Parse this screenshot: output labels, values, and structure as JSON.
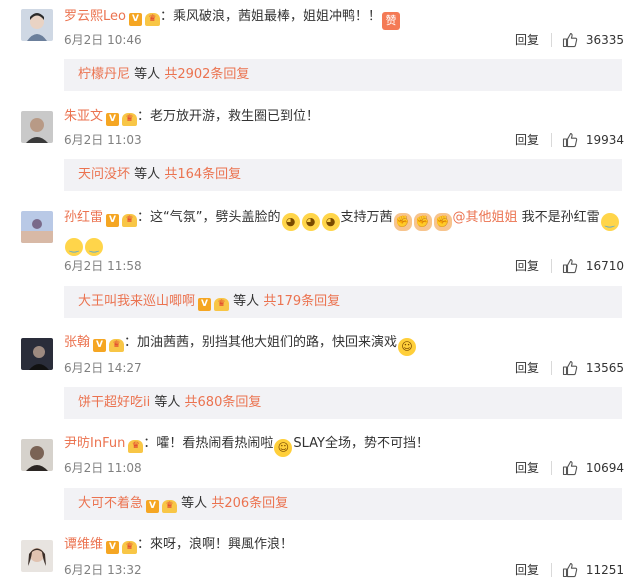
{
  "ui": {
    "reply_label": "回复",
    "etc_label": "等人",
    "badge_v": "V",
    "badge_vip": "♛"
  },
  "comments": [
    {
      "username": "罗云熙Leo",
      "text_parts": [
        "：乘风破浪，茜姐最棒，姐姐冲鸭！！"
      ],
      "emojis": [
        "like-icon"
      ],
      "date": "6月2日 10:46",
      "likes": "36335",
      "reply_user": "柠檬丹尼",
      "reply_total": "共2902条回复"
    },
    {
      "username": "朱亚文",
      "text_parts": [
        "：老万放开游，救生圈已到位！"
      ],
      "date": "6月2日 11:03",
      "likes": "19934",
      "reply_user": "天问没坏",
      "reply_total": "共164条回复"
    },
    {
      "username": "孙红雷",
      "text_parts": [
        "：这“气氛”，劈头盖脸的",
        "支持万茜",
        "@其他姐姐",
        " 我不是孙红雷"
      ],
      "date": "6月2日 11:58",
      "likes": "16710",
      "reply_user": "大王叫我来巡山唧啊",
      "reply_total": "共179条回复"
    },
    {
      "username": "张翰",
      "text_parts": [
        "：加油茜茜，别挡其他大姐们的路，快回来演戏"
      ],
      "date": "6月2日 14:27",
      "likes": "13565",
      "reply_user": "饼干超好吃ii",
      "reply_total": "共680条回复"
    },
    {
      "username": "尹昉InFun",
      "text_parts": [
        "：嚯！看热闹看热闹啦",
        "SLAY全场，势不可挡！"
      ],
      "date": "6月2日 11:08",
      "likes": "10694",
      "reply_user": "大可不着急",
      "reply_total": "共206条回复"
    },
    {
      "username": "谭维维",
      "text_parts": [
        "：來呀，浪啊！興風作浪！"
      ],
      "date": "6月2日 13:32",
      "likes": "11251"
    }
  ]
}
